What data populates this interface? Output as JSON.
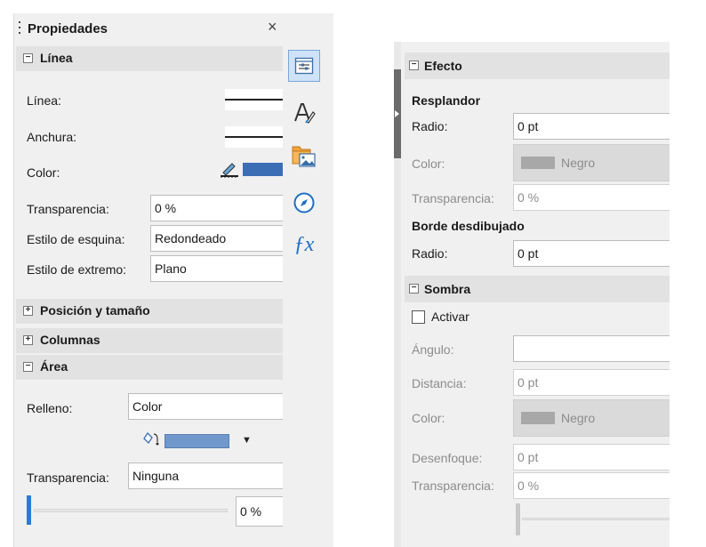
{
  "left": {
    "title": "Propiedades",
    "line_section": {
      "title": "Línea",
      "line_label": "Línea:",
      "width_label": "Anchura:",
      "color_label": "Color:",
      "transparency_label": "Transparencia:",
      "transparency_value": "0 %",
      "corner_label": "Estilo de esquina:",
      "corner_value": "Redondeado",
      "cap_label": "Estilo de extremo:",
      "cap_value": "Plano"
    },
    "position_section": {
      "title": "Posición y tamaño"
    },
    "columns_section": {
      "title": "Columnas"
    },
    "area_section": {
      "title": "Área",
      "fill_label": "Relleno:",
      "fill_value": "Color",
      "transparency_label": "Transparencia:",
      "transparency_value": "Ninguna",
      "slider_value": "0 %"
    }
  },
  "right": {
    "effect_section": {
      "title": "Efecto",
      "glow_title": "Resplandor",
      "glow_radius_label": "Radio:",
      "glow_radius_value": "0 pt",
      "glow_color_label": "Color:",
      "glow_color_name": "Negro",
      "glow_transparency_label": "Transparencia:",
      "glow_transparency_value": "0 %",
      "soft_edge_title": "Borde desdibujado",
      "soft_edge_radius_label": "Radio:",
      "soft_edge_radius_value": "0 pt"
    },
    "shadow_section": {
      "title": "Sombra",
      "enable_label": "Activar",
      "angle_label": "Ángulo:",
      "angle_value": "",
      "distance_label": "Distancia:",
      "distance_value": "0 pt",
      "color_label": "Color:",
      "color_name": "Negro",
      "blur_label": "Desenfoque:",
      "blur_value": "0 pt",
      "transparency_label": "Transparencia:",
      "transparency_value": "0 %"
    }
  },
  "colors": {
    "line_color": "#3b6eb4",
    "fill_color": "#7098cc",
    "accent": "#2a7bd6"
  }
}
